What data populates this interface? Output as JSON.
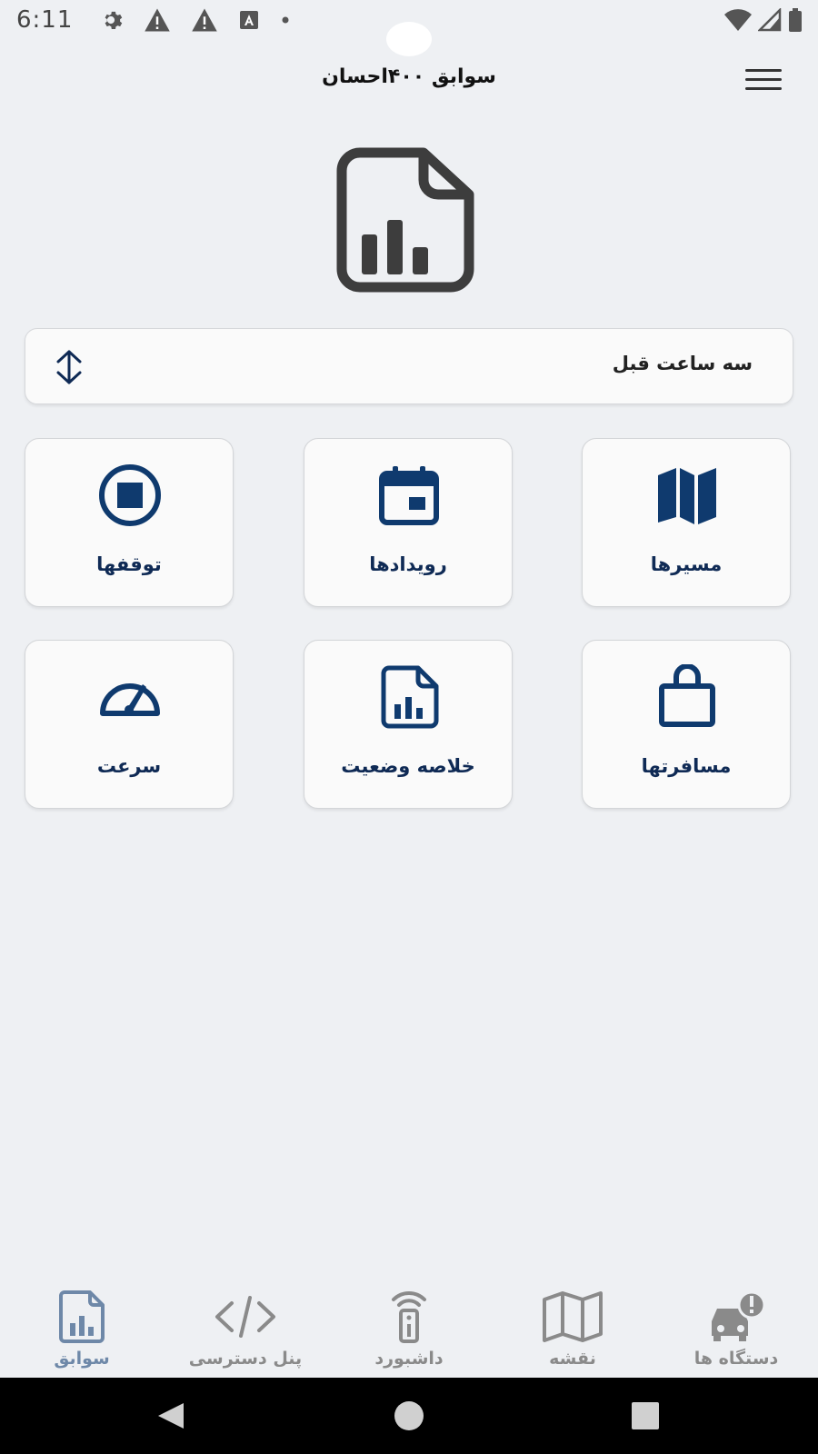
{
  "status_bar": {
    "time": "6:11",
    "left_icons": [
      "gear-icon",
      "warning-icon",
      "warning-icon",
      "a-badge-icon",
      "dot-icon"
    ],
    "right_icons": [
      "wifi-icon",
      "signal-icon",
      "battery-icon"
    ]
  },
  "header": {
    "title": "سوابق ۴۰۰احسان"
  },
  "hero": {
    "icon": "report-file-icon"
  },
  "range_selector": {
    "label": "سه ساعت قبل",
    "icon": "expand-arrows-icon"
  },
  "tiles": [
    {
      "label": "مسیرها",
      "icon": "map-icon"
    },
    {
      "label": "رویدادها",
      "icon": "calendar-icon"
    },
    {
      "label": "توقفها",
      "icon": "stop-circle-icon"
    },
    {
      "label": "مسافرتها",
      "icon": "bag-icon"
    },
    {
      "label": "خلاصه وضعیت",
      "icon": "report-file-icon"
    },
    {
      "label": "سرعت",
      "icon": "speedometer-icon"
    }
  ],
  "bottom_nav": [
    {
      "label": "دستگاه ها",
      "icon": "car-alert-icon"
    },
    {
      "label": "نقشه",
      "icon": "map-icon"
    },
    {
      "label": "داشبورد",
      "icon": "remote-icon"
    },
    {
      "label": "پنل دسترسی",
      "icon": "code-icon"
    },
    {
      "label": "سوابق",
      "icon": "report-file-icon",
      "active": true
    }
  ],
  "colors": {
    "background": "#eef0f3",
    "tile_icon": "#0f3a6e",
    "tile_text": "#0f2a55",
    "nav_inactive": "#8a8a8a",
    "nav_active": "#6e88a8"
  }
}
